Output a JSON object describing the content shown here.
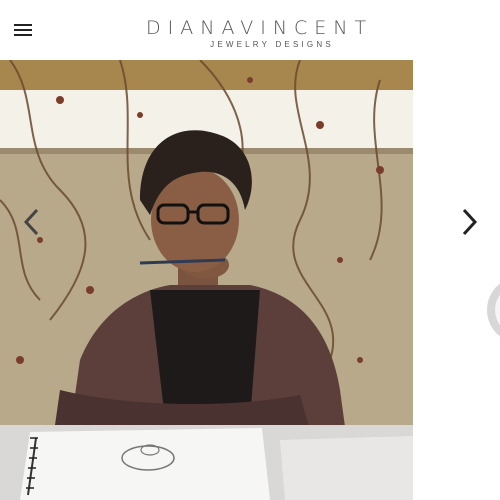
{
  "brand": {
    "name": "DIANAVINCENT",
    "tagline": "JEWELRY DESIGNS"
  },
  "header": {
    "menu_icon": "hamburger-menu-icon"
  },
  "slider": {
    "prev_icon": "chevron-left-icon",
    "next_icon": "chevron-right-icon",
    "main_slide": "photo of a woman with glasses sketching a ring design at a table",
    "next_slide": "partially visible jewelry photo"
  }
}
